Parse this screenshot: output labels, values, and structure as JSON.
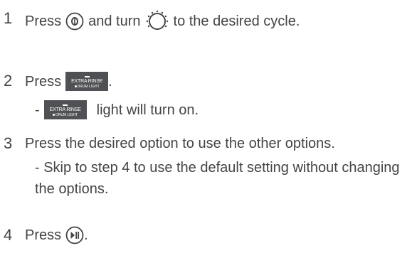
{
  "steps": [
    {
      "number": "1",
      "text_a": "Press",
      "text_b": "and turn",
      "text_c": "to the desired cycle.",
      "icons": [
        "power-button-icon",
        "cycle-dial-icon"
      ]
    },
    {
      "number": "2",
      "text_a": "Press",
      "text_end": ".",
      "button": {
        "main": "EXTRA RINSE",
        "sub": "DRUM LIGHT"
      },
      "sub_dash": "-",
      "sub_text": "light will turn on."
    },
    {
      "number": "3",
      "text": "Press the desired option to use the other options.",
      "sub_text": "- Skip to step 4 to use the default setting without changing the options."
    },
    {
      "number": "4",
      "text_a": "Press",
      "text_end": ".",
      "icons": [
        "start-pause-button-icon"
      ]
    }
  ],
  "colors": {
    "text": "#444444",
    "button_bg": "#4f5155",
    "button_text": "#ffffff"
  }
}
